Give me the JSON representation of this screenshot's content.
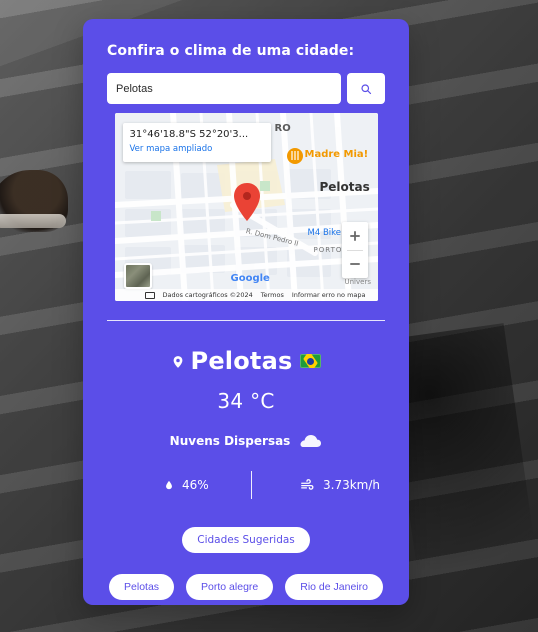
{
  "card": {
    "title": "Confira o clima de uma cidade:",
    "search": {
      "value": "Pelotas",
      "placeholder": ""
    },
    "map": {
      "info_box": {
        "coords": "31°46'18.8\"S 52°20'3...",
        "view_larger": "Ver mapa ampliado"
      },
      "labels": {
        "city": "Pelotas",
        "poi": "Madre Mia!",
        "street": "R. Dom Pedro II",
        "bike": "M4 Bike",
        "porto": "PORTO",
        "univers": "Univers",
        "top_fragment": "RO",
        "google": "Google"
      },
      "footer": {
        "data": "Dados cartográficos ©2024",
        "terms": "Termos",
        "report": "Informar erro no mapa"
      }
    },
    "weather": {
      "city": "Pelotas",
      "temperature": "34 °C",
      "condition": "Nuvens Dispersas",
      "humidity": "46%",
      "wind": "3.73km/h"
    },
    "suggestions": {
      "title": "Cidades Sugeridas",
      "items": [
        {
          "label": "Pelotas"
        },
        {
          "label": "Porto alegre"
        },
        {
          "label": "Rio de Janeiro"
        }
      ]
    }
  },
  "colors": {
    "accent": "#5b4ee8",
    "map_pin": "#ea4335",
    "map_poi": "#f29900",
    "map_text_blue": "#1a73e8"
  },
  "icons": {
    "search": "search-icon",
    "pin": "location-pin-icon",
    "cloud": "cloud-icon",
    "humidity": "water-drop-icon",
    "wind": "wind-icon",
    "flag": "brazil-flag-icon"
  }
}
